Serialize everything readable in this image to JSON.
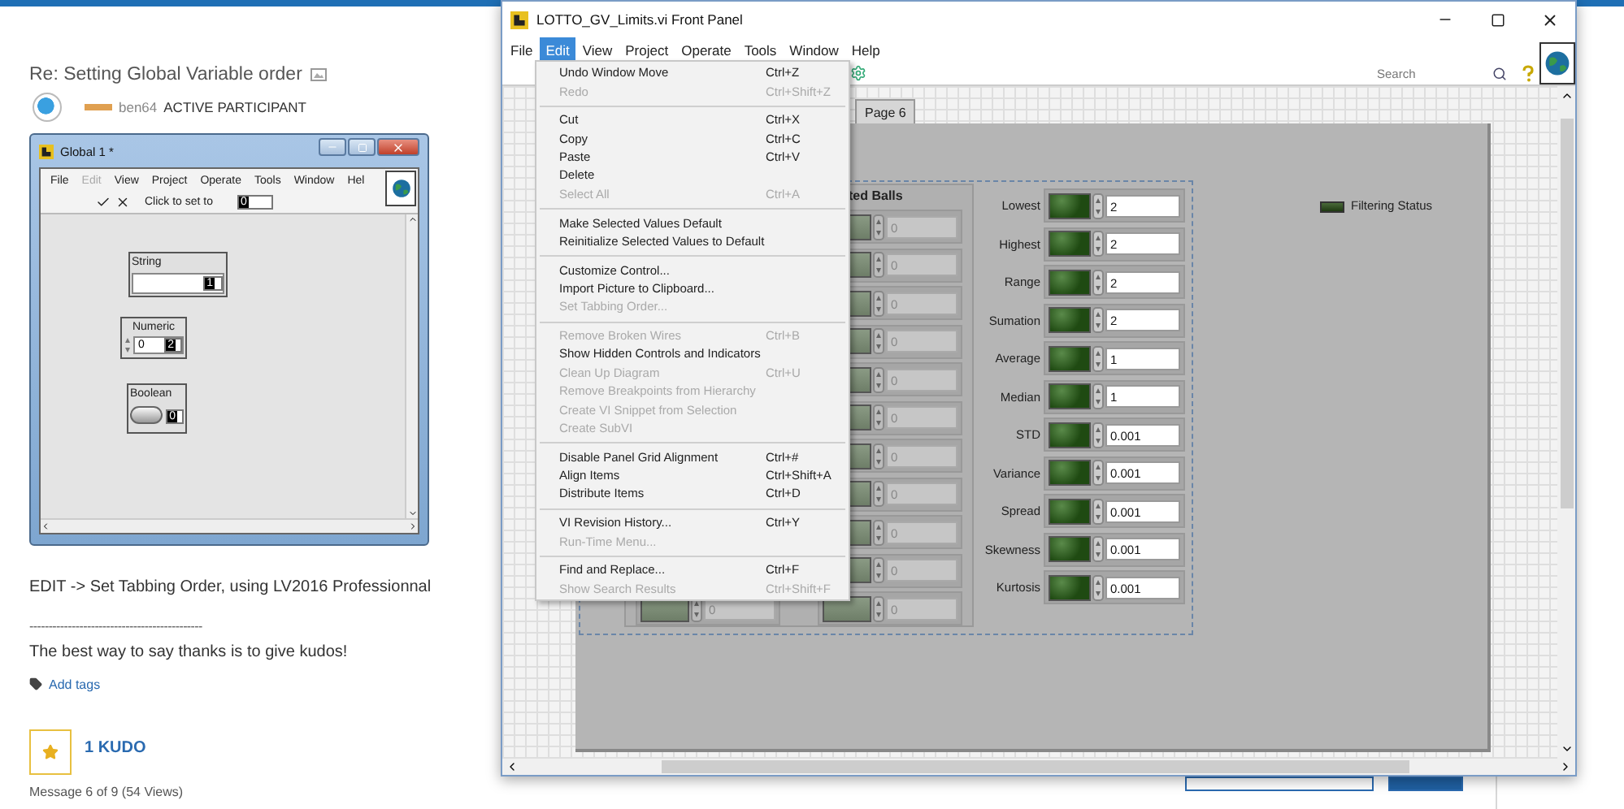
{
  "page": {
    "title": "Re: Setting Global Variable order",
    "author": "ben64",
    "rank": "ACTIVE PARTICIPANT",
    "body": "EDIT -> Set Tabbing Order, using LV2016 Professionnal",
    "rule": "---------------------------------------------",
    "signature": "The best way to say thanks is to give kudos!",
    "tags_link": "Add tags",
    "kudos": "1 KUDO",
    "message_info": "Message 6 of 9 (54 Views)"
  },
  "embedded_window": {
    "title": "Global 1 *",
    "menu": [
      {
        "label": "File",
        "disabled": false
      },
      {
        "label": "Edit",
        "disabled": true
      },
      {
        "label": "View",
        "disabled": false
      },
      {
        "label": "Project",
        "disabled": false
      },
      {
        "label": "Operate",
        "disabled": false
      },
      {
        "label": "Tools",
        "disabled": false
      },
      {
        "label": "Window",
        "disabled": false
      },
      {
        "label": "Hel",
        "disabled": false
      }
    ],
    "toolbar_text": "Click to set to",
    "tab_index_field": "0",
    "controls": [
      {
        "kind": "string",
        "label": "String",
        "index": "1"
      },
      {
        "kind": "numeric",
        "label": "Numeric",
        "value": "0",
        "index": "2"
      },
      {
        "kind": "boolean",
        "label": "Boolean",
        "index": "0"
      }
    ]
  },
  "window": {
    "title": "LOTTO_GV_Limits.vi Front Panel",
    "menu": [
      {
        "label": "File",
        "selected": false
      },
      {
        "label": "Edit",
        "selected": true
      },
      {
        "label": "View",
        "selected": false
      },
      {
        "label": "Project",
        "selected": false
      },
      {
        "label": "Operate",
        "selected": false
      },
      {
        "label": "Tools",
        "selected": false
      },
      {
        "label": "Window",
        "selected": false
      },
      {
        "label": "Help",
        "selected": false
      }
    ],
    "search": {
      "placeholder": "Search"
    },
    "edit_menu": [
      {
        "kind": "item",
        "label": "Undo Window Move",
        "shortcut": "Ctrl+Z",
        "disabled": false
      },
      {
        "kind": "item",
        "label": "Redo",
        "shortcut": "Ctrl+Shift+Z",
        "disabled": true
      },
      {
        "kind": "separator"
      },
      {
        "kind": "item",
        "label": "Cut",
        "shortcut": "Ctrl+X",
        "disabled": false
      },
      {
        "kind": "item",
        "label": "Copy",
        "shortcut": "Ctrl+C",
        "disabled": false
      },
      {
        "kind": "item",
        "label": "Paste",
        "shortcut": "Ctrl+V",
        "disabled": false
      },
      {
        "kind": "item",
        "label": "Delete",
        "disabled": false
      },
      {
        "kind": "item",
        "label": "Select All",
        "shortcut": "Ctrl+A",
        "disabled": true
      },
      {
        "kind": "separator"
      },
      {
        "kind": "item",
        "label": "Make Selected Values Default",
        "disabled": false
      },
      {
        "kind": "item",
        "label": "Reinitialize Selected Values to Default",
        "disabled": false
      },
      {
        "kind": "separator"
      },
      {
        "kind": "item",
        "label": "Customize Control...",
        "disabled": false
      },
      {
        "kind": "item",
        "label": "Import Picture to Clipboard...",
        "disabled": false
      },
      {
        "kind": "item",
        "label": "Set Tabbing Order...",
        "disabled": true
      },
      {
        "kind": "separator"
      },
      {
        "kind": "item",
        "label": "Remove Broken Wires",
        "shortcut": "Ctrl+B",
        "disabled": true
      },
      {
        "kind": "item",
        "label": "Show Hidden Controls and Indicators",
        "disabled": false
      },
      {
        "kind": "item",
        "label": "Clean Up Diagram",
        "shortcut": "Ctrl+U",
        "disabled": true
      },
      {
        "kind": "item",
        "label": "Remove Breakpoints from Hierarchy",
        "disabled": true
      },
      {
        "kind": "item",
        "label": "Create VI Snippet from Selection",
        "disabled": true
      },
      {
        "kind": "item",
        "label": "Create SubVI",
        "disabled": true
      },
      {
        "kind": "separator"
      },
      {
        "kind": "item",
        "label": "Disable Panel Grid Alignment",
        "shortcut": "Ctrl+#",
        "disabled": false
      },
      {
        "kind": "item",
        "label": "Align Items",
        "shortcut": "Ctrl+Shift+A",
        "disabled": false
      },
      {
        "kind": "item",
        "label": "Distribute Items",
        "shortcut": "Ctrl+D",
        "disabled": false
      },
      {
        "kind": "separator"
      },
      {
        "kind": "item",
        "label": "VI Revision History...",
        "shortcut": "Ctrl+Y",
        "disabled": false
      },
      {
        "kind": "item",
        "label": "Run-Time Menu...",
        "disabled": true
      },
      {
        "kind": "separator"
      },
      {
        "kind": "item",
        "label": "Find and Replace...",
        "shortcut": "Ctrl+F",
        "disabled": false
      },
      {
        "kind": "item",
        "label": "Show Search Results",
        "shortcut": "Ctrl+Shift+F",
        "disabled": true
      }
    ],
    "tabs": [
      {
        "label": "Page 6",
        "selected": false
      }
    ],
    "cluster": {
      "title": "ted Balls",
      "column_a": [
        "0"
      ],
      "column_b": [
        "0",
        "0",
        "0",
        "0",
        "0",
        "0",
        "0",
        "0",
        "0",
        "0",
        "0"
      ]
    },
    "statistics": [
      {
        "label": "Lowest",
        "value": "2"
      },
      {
        "label": "Highest",
        "value": "2"
      },
      {
        "label": "Range",
        "value": "2"
      },
      {
        "label": "Sumation",
        "value": "2"
      },
      {
        "label": "Average",
        "value": "1"
      },
      {
        "label": "Median",
        "value": "1"
      },
      {
        "label": "STD",
        "value": "0.001"
      },
      {
        "label": "Variance",
        "value": "0.001"
      },
      {
        "label": "Spread",
        "value": "0.001"
      },
      {
        "label": "Skewness",
        "value": "0.001"
      },
      {
        "label": "Kurtosis",
        "value": "0.001"
      }
    ],
    "indicator": {
      "label": "Filtering Status",
      "on": false
    }
  }
}
